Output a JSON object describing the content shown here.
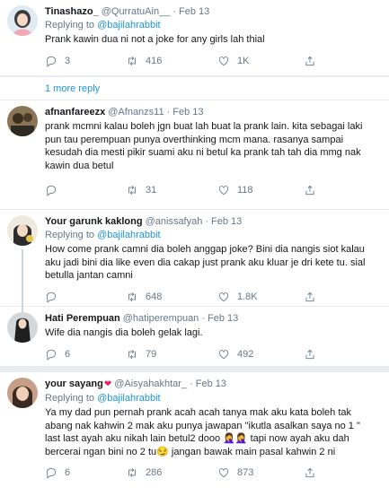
{
  "tweets": [
    {
      "name": "Tinashazo_",
      "handle": "@QurratuAin__",
      "date": "Feb 13",
      "replying_prefix": "Replying to",
      "replying_to": "@bajilahrabbit",
      "text": "Prank kawin dua ni not a joke for any girls lah thial",
      "replies": "3",
      "retweets": "416",
      "likes": "1K",
      "more_replies": "1 more reply",
      "avatar_bg": "#d9e7ef"
    },
    {
      "name": "afnanfareezx",
      "handle": "@Afnanzs11",
      "date": "Feb 13",
      "text": "prank mcmni kalau boleh jgn buat lah buat la prank lain. kita sebagai laki pun tau perempuan punya overthinking mcm mana. rasanya sampai kesudah dia mesti pikir suami aku ni betul ka prank tah tah dia mmg nak kawin dua betul",
      "replies": "",
      "retweets": "31",
      "likes": "118",
      "avatar_bg": "#6b5a3f"
    },
    {
      "name": "Your garunk kaklong",
      "handle": "@anissafyah",
      "date": "Feb 13",
      "replying_prefix": "Replying to",
      "replying_to": "@bajilahrabbit",
      "text": "How come prank camni dia boleh anggap joke? Bini dia nangis siot kalau aku jadi bini dia like even dia cakap just prank aku kluar je dri kete tu. sial betulla jantan camni",
      "replies": "",
      "retweets": "648",
      "likes": "1.8K",
      "avatar_bg": "#e9e4da"
    },
    {
      "name": "Hati Perempuan",
      "handle": "@hatiperempuan",
      "date": "Feb 13",
      "text": "Wife dia nangis dia boleh gelak lagi.",
      "replies": "6",
      "retweets": "79",
      "likes": "492",
      "avatar_bg": "#cfd3d6"
    },
    {
      "name": "your sayang",
      "handle": "@Aisyahakhtar_",
      "date": "Feb 13",
      "replying_prefix": "Replying to",
      "replying_to": "@bajilahrabbit",
      "text_parts": [
        "Ya my dad pun pernah prank acah acah tanya mak aku kata boleh tak abang nak kahwin 2 mak aku punya jawapan \"ikutla asalkan saya no 1 \" last last ayah aku nikah lain betul2 dooo",
        "tapi now ayah aku dah bercerai ngan bini no 2 tu",
        "jangan bawak main pasal kahwin 2 ni"
      ],
      "emoji_facepalm": "🤦‍♀️",
      "emoji_smirk": "😏",
      "replies": "6",
      "retweets": "286",
      "likes": "873",
      "avatar_bg": "#caa28d"
    }
  ],
  "icons": {
    "reply": "reply-icon",
    "retweet": "retweet-icon",
    "like": "like-icon",
    "share": "share-icon",
    "heart_badge": "red-heart-icon"
  },
  "colors": {
    "link": "#1b95e0",
    "muted": "#657786",
    "text": "#14171a",
    "border": "#e6ecf0",
    "heart": "#e0245e"
  }
}
